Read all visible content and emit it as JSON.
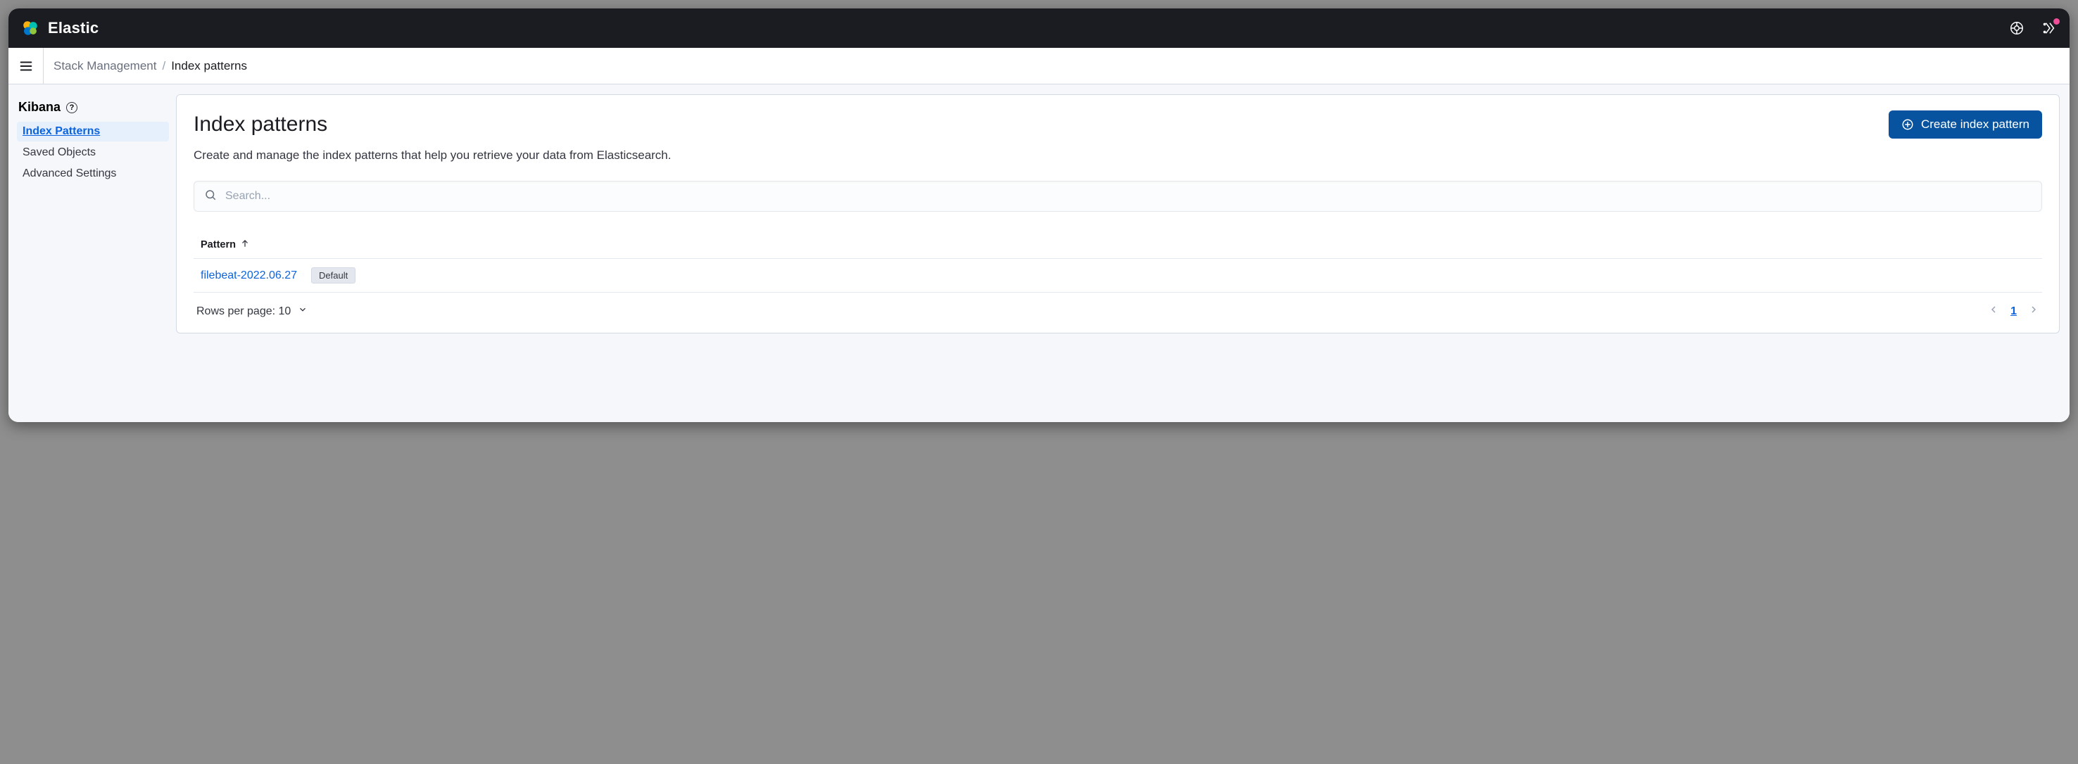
{
  "topbar": {
    "product": "Elastic"
  },
  "breadcrumbs": {
    "parent": "Stack Management",
    "current": "Index patterns"
  },
  "sidebar": {
    "section": "Kibana",
    "items": [
      {
        "label": "Index Patterns",
        "active": true
      },
      {
        "label": "Saved Objects",
        "active": false
      },
      {
        "label": "Advanced Settings",
        "active": false
      }
    ]
  },
  "page": {
    "title": "Index patterns",
    "description": "Create and manage the index patterns that help you retrieve your data from Elasticsearch.",
    "create_button": "Create index pattern"
  },
  "search": {
    "placeholder": "Search..."
  },
  "table": {
    "column": "Pattern",
    "rows": [
      {
        "name": "filebeat-2022.06.27",
        "badge": "Default"
      }
    ]
  },
  "pagination": {
    "rows_label": "Rows per page: 10",
    "current": "1"
  }
}
